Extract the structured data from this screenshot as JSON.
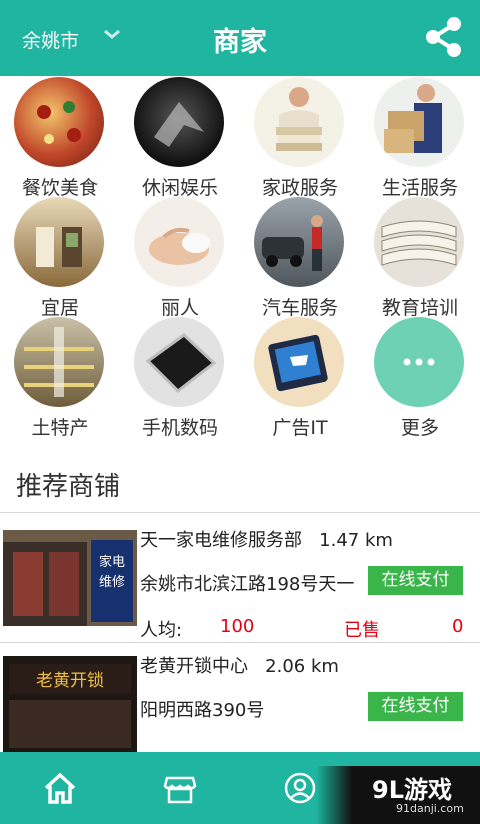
{
  "header": {
    "city": "余姚市",
    "title": "商家"
  },
  "categories": [
    {
      "label": "餐饮美食"
    },
    {
      "label": "休闲娱乐"
    },
    {
      "label": "家政服务"
    },
    {
      "label": "生活服务"
    },
    {
      "label": "宜居"
    },
    {
      "label": "丽人"
    },
    {
      "label": "汽车服务"
    },
    {
      "label": "教育培训"
    },
    {
      "label": "土特产"
    },
    {
      "label": "手机数码"
    },
    {
      "label": "广告IT"
    },
    {
      "label": "更多"
    }
  ],
  "recommended": {
    "title": "推荐商铺",
    "shops": [
      {
        "name": "天一家电维修服务部",
        "distance": "1.47 km",
        "address": "余姚市北滨江路198号天一",
        "pay": "在线支付",
        "avg_label": "人均:",
        "avg": "100",
        "sold_label": "已售",
        "sold": "0"
      },
      {
        "name": "老黄开锁中心",
        "distance": "2.06 km",
        "address": "阳明西路390号",
        "pay": "在线支付"
      }
    ]
  },
  "brand": {
    "name": "9L游戏",
    "url": "91danji.com"
  },
  "colors": {
    "primary": "#1fb5a0",
    "pay": "#3ab54a",
    "price": "#e60012"
  }
}
